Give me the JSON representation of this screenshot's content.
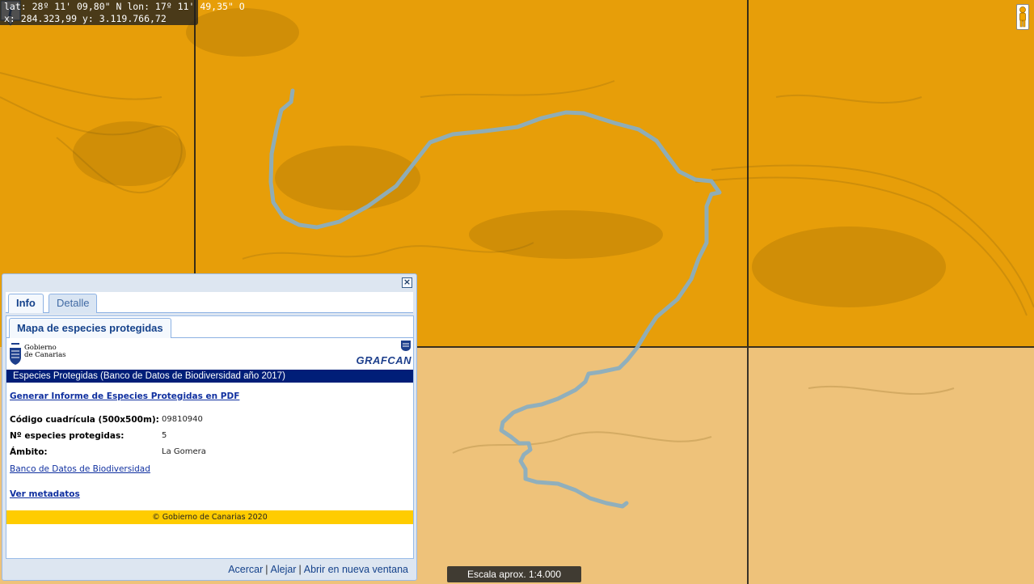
{
  "coords": {
    "latlon": "lat: 28º 11' 09,80\" N  lon: 17º 11' 49,35\" O",
    "xy": "x: 284.323,99  y: 3.119.766,72"
  },
  "scale": {
    "text": "Escala aprox. 1:4.000"
  },
  "colors": {
    "map_overlay": "#f0a000",
    "route": "#8aaec0",
    "banner": "#001e78",
    "footer_strip": "#ffcc00"
  },
  "popup": {
    "tabs": [
      {
        "label": "Info",
        "active": true
      },
      {
        "label": "Detalle",
        "active": false
      }
    ],
    "subtab": "Mapa de especies protegidas",
    "logos": {
      "gobierno_line1": "Gobierno",
      "gobierno_line2": "de Canarias",
      "grafcan": "GRAFCAN"
    },
    "banner": "Especies Protegidas (Banco de Datos de Biodiversidad año 2017)",
    "report_link": "Generar Informe de Especies Protegidas en PDF",
    "fields": [
      {
        "label": "Código cuadrícula (500x500m):",
        "value": "09810940"
      },
      {
        "label": "Nº especies protegidas:",
        "value": "5"
      },
      {
        "label": "Ámbito:",
        "value": "La Gomera"
      }
    ],
    "biodiversity_link": "Banco de Datos de Biodiversidad",
    "metadata_link": "Ver metadatos",
    "copyright": "© Gobierno de Canarias 2020",
    "close_icon": "close-icon",
    "actions": {
      "zoom_in": "Acercar",
      "zoom_out": "Alejar",
      "open_new": "Abrir en nueva ventana",
      "separator": "|"
    }
  },
  "marker": {
    "symbol": "i"
  }
}
